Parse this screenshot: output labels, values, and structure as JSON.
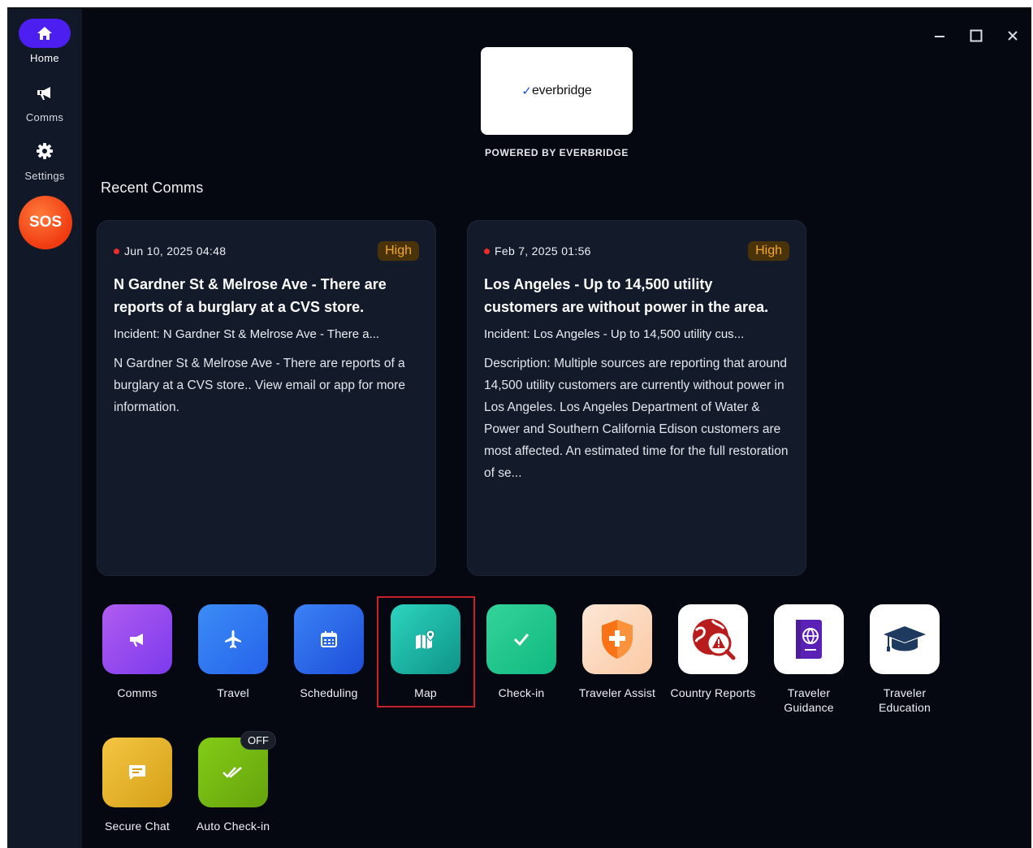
{
  "sidebar": {
    "items": [
      {
        "label": "Home",
        "icon": "home-icon",
        "active": true
      },
      {
        "label": "Comms",
        "icon": "megaphone-icon",
        "active": false
      },
      {
        "label": "Settings",
        "icon": "gear-icon",
        "active": false
      }
    ],
    "sos_label": "SOS"
  },
  "window_controls": {
    "minimize": "minimize-icon",
    "maximize": "maximize-icon",
    "close": "close-icon"
  },
  "brand": {
    "logo_text": "everbridge",
    "powered_by": "POWERED BY EVERBRIDGE"
  },
  "recent_comms": {
    "title": "Recent Comms",
    "cards": [
      {
        "date": "Jun 10, 2025 04:48",
        "priority": "High",
        "title": "N Gardner St & Melrose Ave - There are reports of a burglary at a CVS store.",
        "incident": "Incident: N Gardner St & Melrose Ave - There a...",
        "description": "N Gardner St & Melrose Ave - There are reports of a burglary at a CVS store.. View email or app for more information."
      },
      {
        "date": "Feb 7, 2025 01:56",
        "priority": "High",
        "title": "Los Angeles - Up to 14,500 utility customers are without power in the area.",
        "incident": "Incident: Los Angeles - Up to 14,500 utility cus...",
        "description": "Description: Multiple sources are reporting that around 14,500 utility customers are currently without power in Los Angeles. Los Angeles Department of Water & Power and Southern California Edison customers are most affected. An estimated time for the full restoration of se..."
      }
    ]
  },
  "apps": [
    {
      "label": "Comms",
      "icon": "megaphone-icon"
    },
    {
      "label": "Travel",
      "icon": "airplane-icon"
    },
    {
      "label": "Scheduling",
      "icon": "calendar-icon"
    },
    {
      "label": "Map",
      "icon": "map-icon"
    },
    {
      "label": "Check-in",
      "icon": "checkmark-icon"
    },
    {
      "label": "Traveler Assist",
      "icon": "medical-shield-icon"
    },
    {
      "label": "Country Reports",
      "icon": "globe-alert-icon"
    },
    {
      "label": "Traveler Guidance",
      "icon": "passport-icon"
    },
    {
      "label": "Traveler Education",
      "icon": "graduation-cap-icon"
    },
    {
      "label": "Secure Chat",
      "icon": "chat-icon"
    },
    {
      "label": "Auto Check-in",
      "icon": "double-check-icon",
      "badge": "OFF"
    }
  ],
  "colors": {
    "accent": "#4c1ef0",
    "sos": "#f03a10",
    "priority_high": "#f5a623",
    "highlight_border": "#c8202a"
  }
}
